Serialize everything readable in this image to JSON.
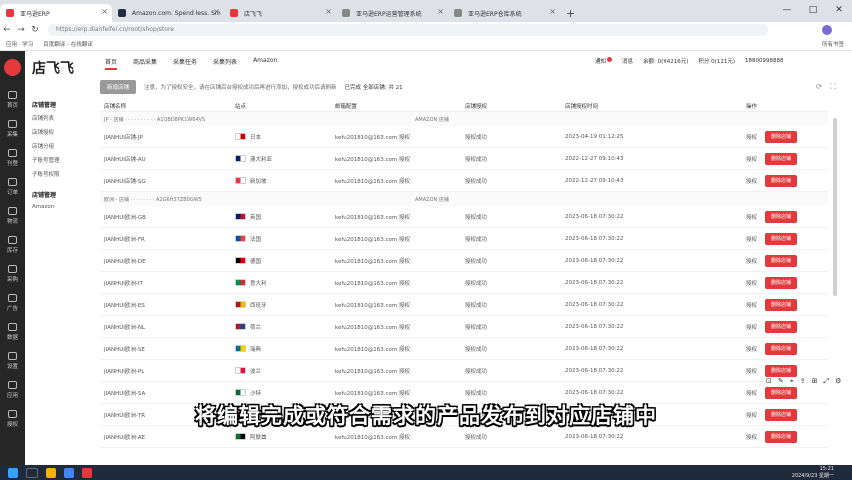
{
  "browser": {
    "tabs": [
      {
        "label": "亚马逊ERP",
        "color": "#e4393c",
        "active": true
      },
      {
        "label": "Amazon.com. Spend less. Sm",
        "color": "#232f3e",
        "active": false
      },
      {
        "label": "店飞飞",
        "color": "#e4393c",
        "active": false
      },
      {
        "label": "亚马逊ERP运营管理系统",
        "color": "#888888",
        "active": false
      },
      {
        "label": "亚马逊ERP仓库系统",
        "color": "#888888",
        "active": false
      }
    ],
    "new_tab": "+",
    "window_controls": [
      "—",
      "□",
      "✕"
    ],
    "url": "https://erp.dianfeifei.cn/root/shop/store",
    "bookmarks": [
      "应用 · 学习",
      "百度翻译 - 在线翻译"
    ],
    "bookmarks_right": "所有书签"
  },
  "sidebar": {
    "items": [
      {
        "label": "首页"
      },
      {
        "label": "采集"
      },
      {
        "label": "刊登"
      },
      {
        "label": "订单"
      },
      {
        "label": "物流"
      },
      {
        "label": "库存"
      },
      {
        "label": "采购"
      },
      {
        "label": "广告"
      },
      {
        "label": "数据"
      },
      {
        "label": "设置"
      },
      {
        "label": "应用"
      },
      {
        "label": "授权"
      }
    ]
  },
  "brand": "店飞飞",
  "topnav": [
    "首页",
    "商品采集",
    "采集任务",
    "采集列表",
    "Amazon"
  ],
  "userbar": {
    "notice": "通知",
    "tab2": "消息",
    "account": "余额: 0(¥4216元)",
    "points": "积分 0(121元)",
    "phone": "18800998888"
  },
  "toolbar": {
    "button": "新增店铺",
    "note": "注意，为了授权安全，请在店铺后台授权成功后再进行添加，授权成功后请刷新",
    "checkbox": "已完成 全部店铺: 共 21"
  },
  "left_menu": {
    "group1": "店铺管理",
    "group1_items": [
      "店铺列表",
      "店铺授权",
      "店铺分组",
      "子账号管理",
      "子账号权限"
    ],
    "group2": "店铺管理",
    "group2_items": [
      "Amazon"
    ]
  },
  "table": {
    "headers": [
      "店铺名称",
      "站点",
      "邮箱配置",
      "店铺授权",
      "店铺授权时间",
      "操作",
      ""
    ],
    "groups": [
      {
        "label": "JP - 店铺 · · · · · · · · · · A1QBD8PK1W64VS",
        "extra": "AMAZON 店铺"
      },
      {
        "label": "欧洲 - 店铺 · · · · · · · · A2G6H37ZB0GW5",
        "extra": "AMAZON 店铺"
      }
    ],
    "rows": [
      {
        "name": "JIANHUI店铺-JP",
        "site": "日本",
        "flag": "#ffffff",
        "flag2": "#d00000",
        "email": "kefu201810@163.com 授权",
        "auth": "授权成功",
        "time": "2023-04-19 01:12:25",
        "op": "授权",
        "del": "删除店铺",
        "group": 0
      },
      {
        "name": "JIANHUI店铺-AU",
        "site": "澳大利亚",
        "flag": "#012169",
        "flag2": "#ffffff",
        "email": "kefu201810@163.com 授权",
        "auth": "授权成功",
        "time": "2022-12-27 09:10:43",
        "op": "授权",
        "del": "删除店铺",
        "group": 0
      },
      {
        "name": "JIANHUI店铺-SG",
        "site": "新加坡",
        "flag": "#ef3340",
        "flag2": "#ffffff",
        "email": "kefu201810@163.com 授权",
        "auth": "授权成功",
        "time": "2022-12-27 09:10:43",
        "op": "授权",
        "del": "删除店铺",
        "group": 0
      },
      {
        "name": "JIANHUI欧洲-GB",
        "site": "英国",
        "flag": "#012169",
        "flag2": "#c8102e",
        "email": "kefu201810@163.com 授权",
        "auth": "授权成功",
        "time": "2023-06-18 07:30:22",
        "op": "授权",
        "del": "删除店铺",
        "group": 1
      },
      {
        "name": "JIANHUI欧洲-FR",
        "site": "法国",
        "flag": "#0055a4",
        "flag2": "#ef4135",
        "email": "kefu201810@163.com 授权",
        "auth": "授权成功",
        "time": "2023-06-18 07:30:22",
        "op": "授权",
        "del": "删除店铺",
        "group": 1
      },
      {
        "name": "JIANHUI欧洲-DE",
        "site": "德国",
        "flag": "#000000",
        "flag2": "#dd0000",
        "email": "kefu201810@163.com 授权",
        "auth": "授权成功",
        "time": "2023-06-18 07:30:22",
        "op": "授权",
        "del": "删除店铺",
        "group": 1
      },
      {
        "name": "JIANHUI欧洲-IT",
        "site": "意大利",
        "flag": "#009246",
        "flag2": "#ce2b37",
        "email": "kefu201810@163.com 授权",
        "auth": "授权成功",
        "time": "2023-06-18 07:30:22",
        "op": "授权",
        "del": "删除店铺",
        "group": 1
      },
      {
        "name": "JIANHUI欧洲-ES",
        "site": "西班牙",
        "flag": "#aa151b",
        "flag2": "#f1bf00",
        "email": "kefu201810@163.com 授权",
        "auth": "授权成功",
        "time": "2023-06-18 07:30:22",
        "op": "授权",
        "del": "删除店铺",
        "group": 1
      },
      {
        "name": "JIANHUI欧洲-NL",
        "site": "荷兰",
        "flag": "#ae1c28",
        "flag2": "#21468b",
        "email": "kefu201810@163.com 授权",
        "auth": "授权成功",
        "time": "2023-06-18 07:30:22",
        "op": "授权",
        "del": "删除店铺",
        "group": 1
      },
      {
        "name": "JIANHUI欧洲-SE",
        "site": "瑞典",
        "flag": "#006aa7",
        "flag2": "#fecc00",
        "email": "kefu201810@163.com 授权",
        "auth": "授权成功",
        "time": "2023-06-18 07:30:22",
        "op": "授权",
        "del": "删除店铺",
        "group": 1
      },
      {
        "name": "JIANHUI欧洲-PL",
        "site": "波兰",
        "flag": "#ffffff",
        "flag2": "#dc143c",
        "email": "kefu201810@163.com 授权",
        "auth": "授权成功",
        "time": "2023-06-18 07:30:22",
        "op": "授权",
        "del": "删除店铺",
        "group": 1
      },
      {
        "name": "JIANHUI欧洲-SA",
        "site": "沙特",
        "flag": "#006c35",
        "flag2": "#ffffff",
        "email": "kefu201810@163.com 授权",
        "auth": "授权成功",
        "time": "2023-06-18 07:30:22",
        "op": "授权",
        "del": "删除店铺",
        "group": 1
      },
      {
        "name": "JIANHUI欧洲-TR",
        "site": "土耳其",
        "flag": "#e30a17",
        "flag2": "#ffffff",
        "email": "kefu201810@163.com 授权",
        "auth": "授权成功",
        "time": "2023-06-18 07:30:22",
        "op": "授权",
        "del": "删除店铺",
        "group": 1
      },
      {
        "name": "JIANHUI欧洲-AE",
        "site": "阿联酋",
        "flag": "#00732f",
        "flag2": "#000000",
        "email": "kefu201810@163.com 授权",
        "auth": "授权成功",
        "time": "2023-06-18 07:30:22",
        "op": "授权",
        "del": "删除店铺",
        "group": 1
      }
    ]
  },
  "subtitle": "将编辑完成或符合需求的产品发布到对应店铺中",
  "taskbar": {
    "time": "15:21",
    "date": "2024/9/23 星期一"
  }
}
